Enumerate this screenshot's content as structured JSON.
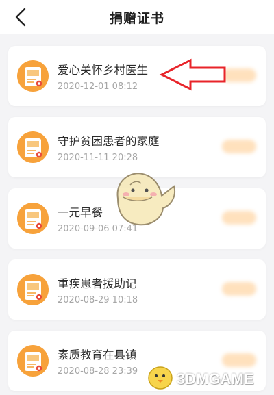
{
  "header": {
    "title": "捐赠证书",
    "back_icon": "chevron-left-icon"
  },
  "certificates": [
    {
      "name": "爱心关怀乡村医生",
      "date": "2020-12-01 08:12"
    },
    {
      "name": "守护贫困患者的家庭",
      "date": "2020-11-11 20:28"
    },
    {
      "name": "一元早餐",
      "date": "2020-09-06 07:41"
    },
    {
      "name": "重疾患者援助记",
      "date": "2020-08-29 10:18"
    },
    {
      "name": "素质教育在县镇",
      "date": "2020-08-28 23:39"
    }
  ],
  "annotation": {
    "icon": "red-arrow-icon",
    "color": "#e8242a"
  },
  "watermark": {
    "text": "3DMGAME"
  },
  "colors": {
    "accent_orange": "#f7a23b",
    "badge_red": "#e94b3c"
  }
}
